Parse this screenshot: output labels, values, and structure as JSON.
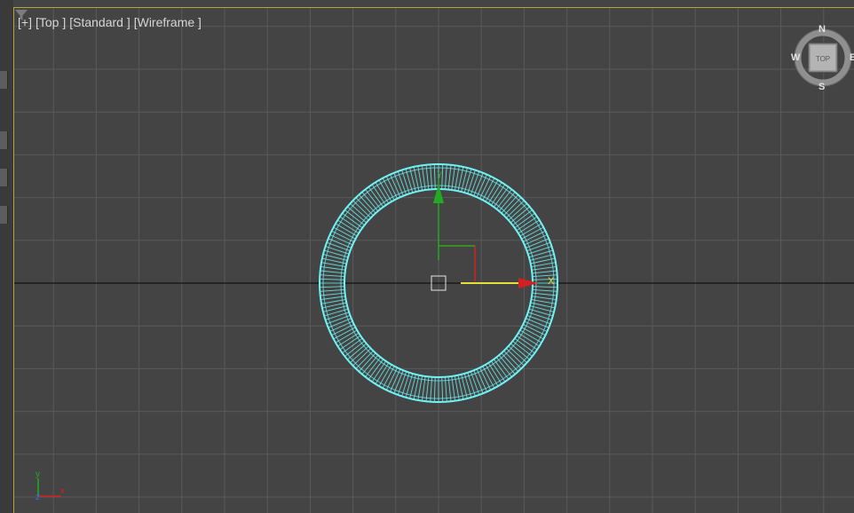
{
  "viewport": {
    "plus_menu": "[+]",
    "view_menu": "[Top ]",
    "shading_style_menu": "[Standard ]",
    "display_mode_menu": "[Wireframe ]"
  },
  "viewcube": {
    "face_label": "TOP",
    "north": "N",
    "south": "S",
    "east": "E",
    "west": "W"
  },
  "gizmo": {
    "x_label": "X",
    "y_label": "Y"
  },
  "axis_tripod": {
    "x_label": "x",
    "y_label": "y",
    "z_label": "z"
  },
  "colors": {
    "viewport_bg": "#444444",
    "grid_line": "#5a5a5a",
    "world_axis": "#111111",
    "selected_object": "#6ff3f5",
    "active_border": "#b9a23a",
    "gizmo_x": "#d12020",
    "gizmo_y": "#22aa22",
    "gizmo_highlight": "#e8e03a"
  }
}
